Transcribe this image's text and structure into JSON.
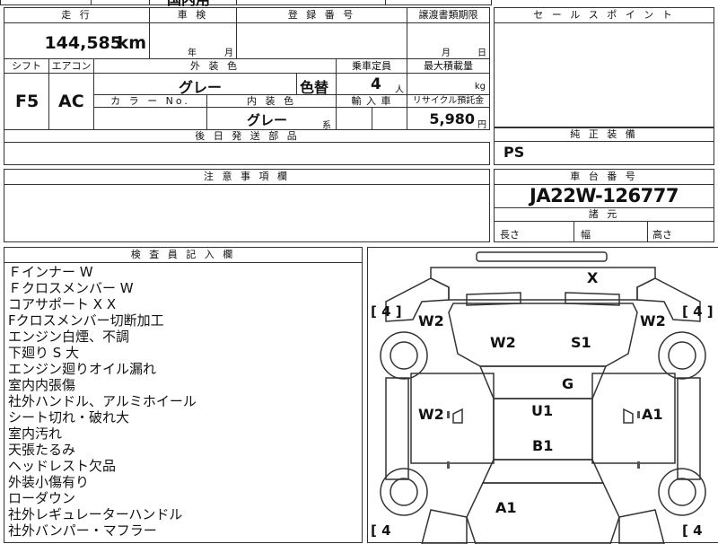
{
  "top_partial": {
    "cut_text": "国内用"
  },
  "sheet": {
    "mileage": {
      "label": "走 行",
      "value": "144,585",
      "unit": "km"
    },
    "inspection": {
      "label": "車 検",
      "year_unit": "年",
      "month_unit": "月"
    },
    "registration_no": {
      "label": "登 録 番 号"
    },
    "transfer_deadline": {
      "label": "譲渡書類期限",
      "month_unit": "月",
      "day_unit": "日"
    },
    "shift": {
      "label": "シフト",
      "value": "F5"
    },
    "aircon": {
      "label": "エアコン",
      "value": "AC"
    },
    "exterior_color": {
      "label": "外 装 色",
      "value": "グレー",
      "color_change": "色替"
    },
    "capacity": {
      "label": "乗車定員",
      "value": "4",
      "unit": "人"
    },
    "max_load": {
      "label": "最大積載量",
      "unit": "kg"
    },
    "color_no": {
      "label": "カ ラ ー No."
    },
    "interior_color": {
      "label": "内 装 色",
      "value": "グレー",
      "suffix": "系"
    },
    "import": {
      "label": "輸 入 車"
    },
    "recycle": {
      "label": "リサイクル預託金",
      "value": "5,980",
      "unit": "円"
    },
    "later_parts": {
      "label": "後 日 発 送 部 品"
    }
  },
  "sales_point": {
    "label": "セ ー ル ス ポ イ ン ト"
  },
  "genuine_equipment": {
    "label": "純 正 装 備",
    "value": "PS"
  },
  "notes": {
    "label": "注 意 事 項 欄"
  },
  "chassis": {
    "label": "車 台 番 号",
    "value": "JA22W-126777",
    "dimensions_label": "諸 元",
    "length": "長さ",
    "width": "幅",
    "height": "高さ"
  },
  "inspector": {
    "label": "検 査 員 記 入 欄",
    "lines": [
      "Ｆインナー W",
      "Ｆクロスメンバー W",
      "コアサポート X X",
      "Fクロスメンバー切断加工",
      "エンジン白煙、不調",
      "下廻り S 大",
      "エンジン廻りオイル漏れ",
      "室内内張傷",
      "社外ハンドル、アルミホイール",
      "シート切れ・破れ大",
      "室内汚れ",
      "天張たるみ",
      "ヘッドレスト欠品",
      "外装小傷有り",
      "ローダウン",
      "社外レギュレーターハンドル",
      "社外バンパー・マフラー"
    ]
  },
  "diagram": {
    "tire_tl": "[ 4 ]",
    "tire_tr": "[ 4 ]",
    "tire_bl": "[ 4",
    "tire_br": "[ 4",
    "marks": {
      "front_top": "X",
      "fl_fender": "W2",
      "fr_fender": "W2",
      "hood_left": "W2",
      "hood_right": "S1",
      "windshield": "G",
      "left_door": "W2",
      "roof": "U1",
      "right_door": "A1",
      "rear_roof": "B1",
      "rear_left": "A1"
    }
  }
}
